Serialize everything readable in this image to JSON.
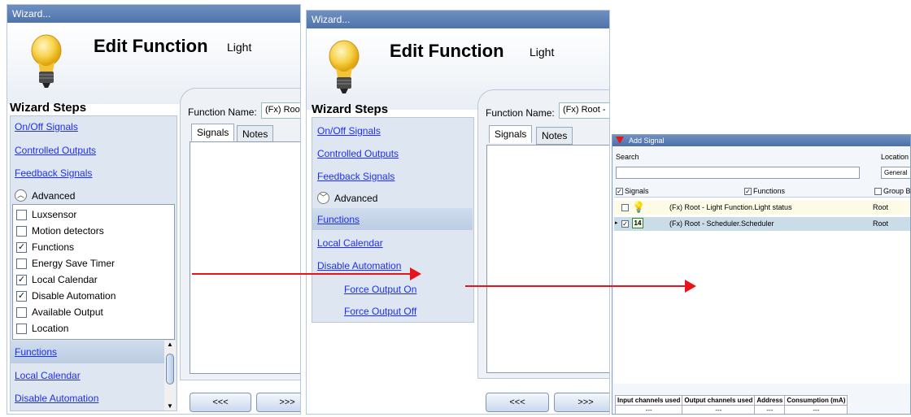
{
  "left_window": {
    "title": "Wizard...",
    "edit_title": "Edit Function",
    "edit_subtitle": "Light",
    "steps_title": "Wizard Steps",
    "steps": [
      "On/Off Signals",
      "Controlled Outputs",
      "Feedback Signals"
    ],
    "advanced_label": "Advanced",
    "advanced_options": [
      {
        "label": "Luxsensor",
        "checked": false
      },
      {
        "label": "Motion detectors",
        "checked": false
      },
      {
        "label": "Functions",
        "checked": true
      },
      {
        "label": "Energy Save Timer",
        "checked": false
      },
      {
        "label": "Local Calendar",
        "checked": true
      },
      {
        "label": "Disable Automation",
        "checked": true
      },
      {
        "label": "Available Output",
        "checked": false
      },
      {
        "label": "Location",
        "checked": false
      }
    ],
    "extra_steps": [
      "Functions",
      "Local Calendar",
      "Disable Automation"
    ],
    "function_name_label": "Function Name:",
    "function_name_value": "(Fx) Root",
    "tabs": [
      "Signals",
      "Notes"
    ],
    "prev_button": "<<<",
    "next_button": ">>>"
  },
  "middle_window": {
    "title": "Wizard...",
    "edit_title": "Edit Function",
    "edit_subtitle": "Light",
    "steps_title": "Wizard Steps",
    "steps": [
      "On/Off Signals",
      "Controlled Outputs",
      "Feedback Signals"
    ],
    "advanced_label": "Advanced",
    "extra_steps": [
      "Functions",
      "Local Calendar",
      "Disable Automation"
    ],
    "sub_steps": [
      "Force Output On",
      "Force Output Off"
    ],
    "function_name_label": "Function Name:",
    "function_name_value": "(Fx) Root -",
    "tabs": [
      "Signals",
      "Notes"
    ],
    "prev_button": "<<<",
    "next_button": ">>>"
  },
  "add_signal": {
    "title": "Add Signal",
    "search_label": "Search",
    "location_label": "Location",
    "location_value": "General",
    "filters": {
      "signals": "Signals",
      "functions": "Functions",
      "group_by": "Group By"
    },
    "rows": [
      {
        "name": "(Fx) Root - Light Function.Light status",
        "location": "Root",
        "checked": false,
        "icon": "lightbulb-icon"
      },
      {
        "name": "(Fx) Root - Scheduler.Scheduler",
        "location": "Root",
        "checked": true,
        "icon": "calendar-icon",
        "icon_text": "14"
      }
    ],
    "footer_headers": [
      "Input channels used",
      "Output channels used",
      "Address",
      "Consumption (mA)"
    ],
    "footer_values": [
      "---",
      "---",
      "---",
      "---"
    ]
  },
  "colors": {
    "arrow": "#e8141b",
    "link": "#1f2ff0",
    "titlebar": "#5a7db3"
  }
}
